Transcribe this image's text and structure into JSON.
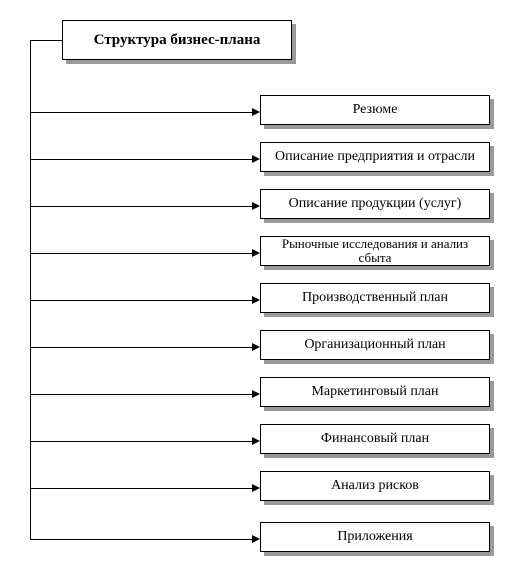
{
  "title": "Структура бизнес-плана",
  "items": [
    "Резюме",
    "Описание предприятия и отрасли",
    "Описание продукции (услуг)",
    "Рыночные исследования и анализ сбыта",
    "Производственный план",
    "Организационный план",
    "Маркетинговый план",
    "Финансовый план",
    "Анализ рисков",
    "Приложения"
  ]
}
